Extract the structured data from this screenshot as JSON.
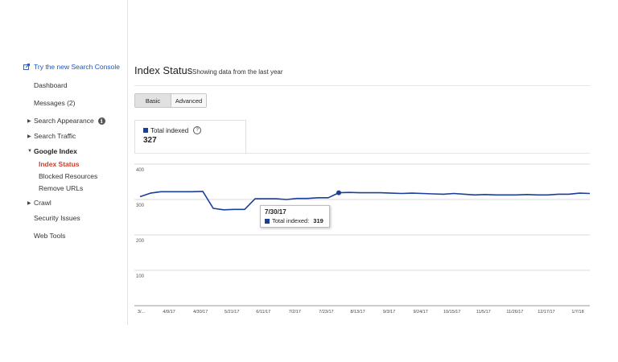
{
  "sidebar": {
    "promo_link": "Try the new Search Console",
    "items": {
      "dashboard": "Dashboard",
      "messages": "Messages (2)",
      "search_appearance": "Search Appearance",
      "search_traffic": "Search Traffic",
      "google_index": "Google Index",
      "index_status": "Index Status",
      "blocked_resources": "Blocked Resources",
      "remove_urls": "Remove URLs",
      "crawl": "Crawl",
      "security_issues": "Security Issues",
      "web_tools": "Web Tools"
    },
    "active_color": "#d23c2a",
    "link_color": "#1a57c8"
  },
  "header": {
    "title": "Index Status",
    "subtitle": "Showing data from the last year"
  },
  "view_toggle": {
    "basic": "Basic",
    "advanced": "Advanced",
    "selected": "Basic"
  },
  "stat_card": {
    "label": "Total indexed",
    "value": "327"
  },
  "tooltip": {
    "date": "7/30/17",
    "label": "Total indexed:",
    "value": "319"
  },
  "chart_data": {
    "type": "line",
    "series": [
      {
        "name": "Total indexed",
        "color": "#1a3f9b",
        "values": [
          308,
          318,
          322,
          322,
          322,
          322,
          323,
          275,
          271,
          272,
          272,
          302,
          302,
          302,
          300,
          303,
          303,
          305,
          305,
          319,
          320,
          319,
          319,
          319,
          318,
          317,
          318,
          317,
          316,
          315,
          317,
          315,
          313,
          314,
          313,
          313,
          313,
          314,
          313,
          313,
          315,
          315,
          318,
          317
        ]
      }
    ],
    "x_tick_labels": [
      "3/...",
      "4/9/17",
      "4/30/17",
      "5/21/17",
      "6/11/17",
      "7/2/17",
      "7/23/17",
      "8/13/17",
      "9/3/17",
      "9/24/17",
      "10/15/17",
      "11/5/17",
      "11/26/17",
      "12/17/17",
      "1/7/18"
    ],
    "y_ticks": [
      100,
      200,
      300,
      400
    ],
    "ylim": [
      0,
      400
    ],
    "highlight": {
      "date": "7/30/17",
      "value": 319
    },
    "grid": true
  }
}
